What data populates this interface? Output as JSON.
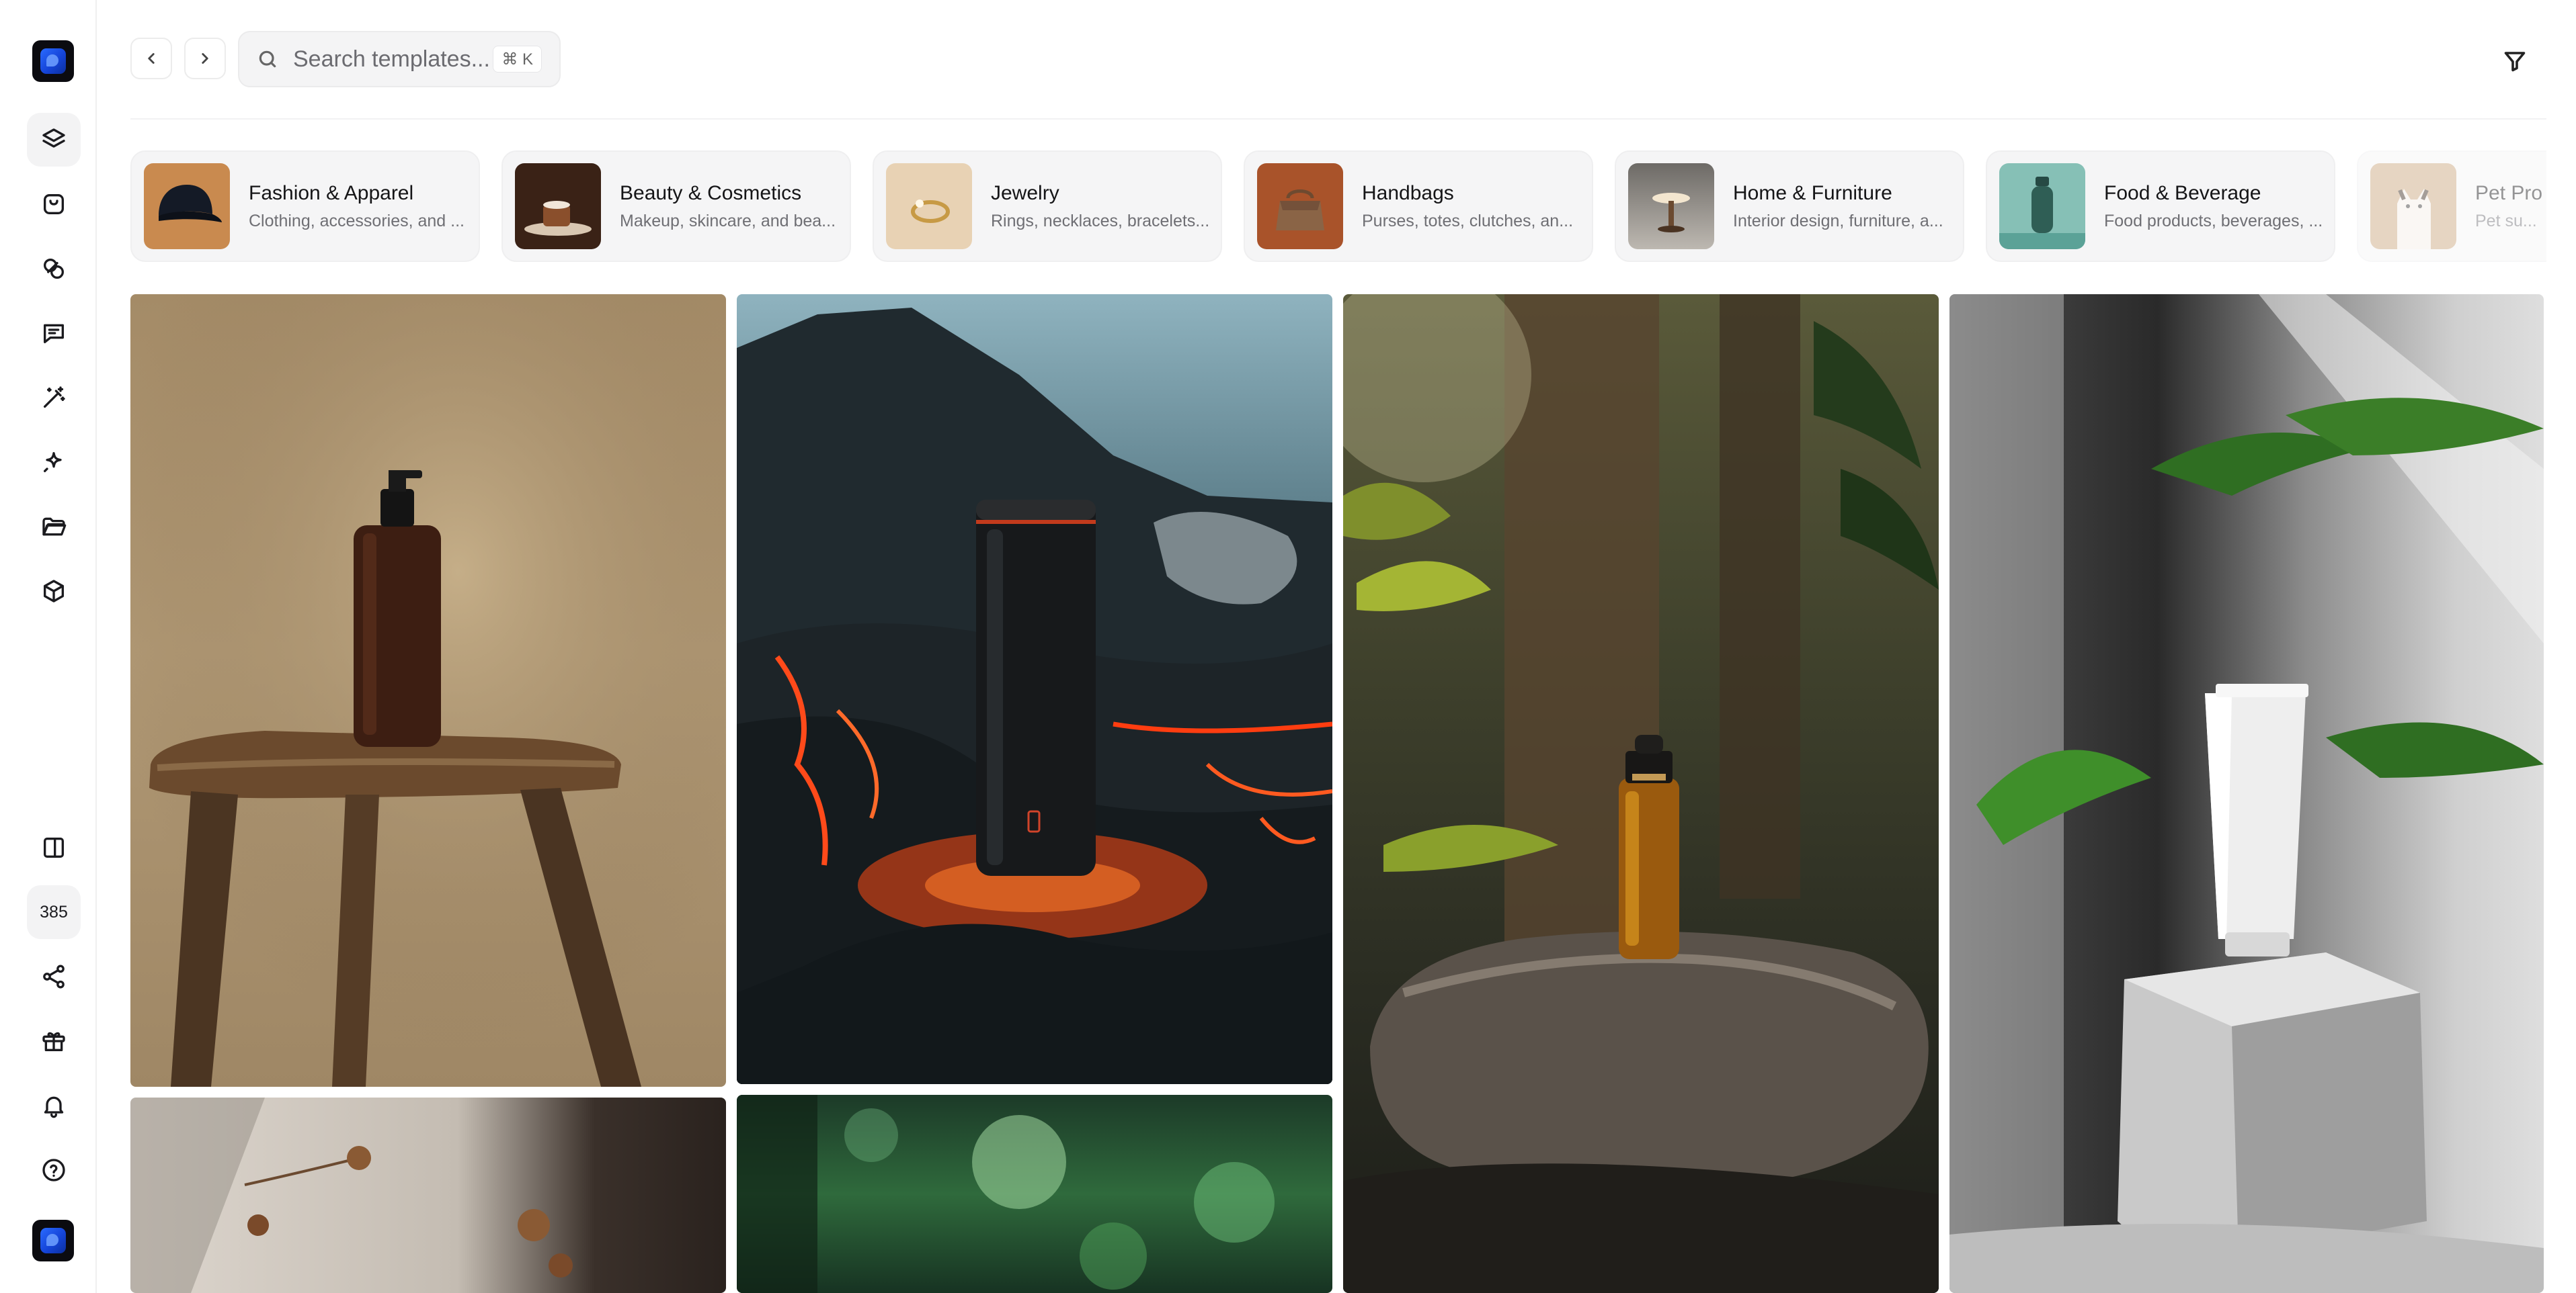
{
  "sidebar": {
    "logo": "app-logo",
    "items": [
      {
        "icon": "layers-icon",
        "active": true
      },
      {
        "icon": "mockup-icon",
        "active": false
      },
      {
        "icon": "swatch-icon",
        "active": false
      },
      {
        "icon": "chat-icon",
        "active": false
      },
      {
        "icon": "magic-wand-icon",
        "active": false
      },
      {
        "icon": "sparkle-icon",
        "active": false
      },
      {
        "icon": "folder-icon",
        "active": false
      },
      {
        "icon": "box-icon",
        "active": false
      }
    ],
    "bottom": {
      "panel_icon": "panel-icon",
      "credits": "385",
      "share_icon": "share-icon",
      "gift_icon": "gift-icon",
      "bell_icon": "bell-icon",
      "help_icon": "help-icon"
    }
  },
  "header": {
    "search_placeholder": "Search templates...",
    "shortcut": "⌘ K",
    "back_icon": "chevron-left-icon",
    "forward_icon": "chevron-right-icon",
    "filter_icon": "filter-icon"
  },
  "categories": [
    {
      "title": "Fashion & Apparel",
      "subtitle": "Clothing, accessories, and ..."
    },
    {
      "title": "Beauty & Cosmetics",
      "subtitle": "Makeup, skincare, and bea..."
    },
    {
      "title": "Jewelry",
      "subtitle": "Rings, necklaces, bracelets..."
    },
    {
      "title": "Handbags",
      "subtitle": "Purses, totes, clutches, an..."
    },
    {
      "title": "Home & Furniture",
      "subtitle": "Interior design, furniture, a..."
    },
    {
      "title": "Food & Beverage",
      "subtitle": "Food products, beverages, ..."
    },
    {
      "title": "Pet Pro",
      "subtitle": "Pet su..."
    }
  ],
  "gallery": [
    "amber-pump-bottle-on-stool",
    "black-tumbler-on-lava",
    "amber-dropper-bottle-in-jungle",
    "white-tube-on-stone-block",
    "dried-flowers-on-wall",
    "green-bokeh-forest"
  ],
  "colors": {
    "accent": "#1544d8",
    "sidebar_active": "#f3f3f4",
    "chip_bg": "#f5f5f6"
  }
}
